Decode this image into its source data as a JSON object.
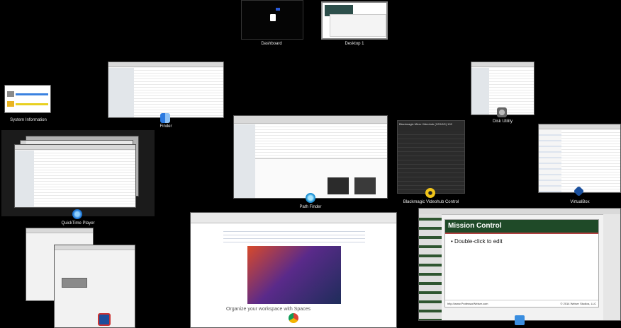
{
  "spaces": [
    {
      "label": "Dashboard"
    },
    {
      "label": "Desktop 1"
    }
  ],
  "windows": {
    "system_information": {
      "label": "System Information"
    },
    "finder": {
      "label": "Finder"
    },
    "disk_utility": {
      "label": "Disk Utility"
    },
    "quicktime_player": {
      "label": "QuickTime Player"
    },
    "path_finder": {
      "label": "Path Finder"
    },
    "blackmagic": {
      "label": "Blackmagic Videohub Control",
      "title": "Blackmagic Micro Videohub (12G/6G) 192"
    },
    "virtualbox": {
      "label": "VirtualBox"
    },
    "chrome": {
      "heading": "Organize your workspace with Spaces"
    },
    "keynote": {
      "slide_title": "Mission Control",
      "bullet": "Double-click to edit",
      "footer_left": "http://www.ProfessorWeiser.com",
      "footer_right": "© 2014 Weiser Studios, LLC"
    }
  },
  "colors": {
    "background": "#000000",
    "keynote_title_bg": "#1f4a28",
    "accent_blue": "#1f6fd1"
  }
}
